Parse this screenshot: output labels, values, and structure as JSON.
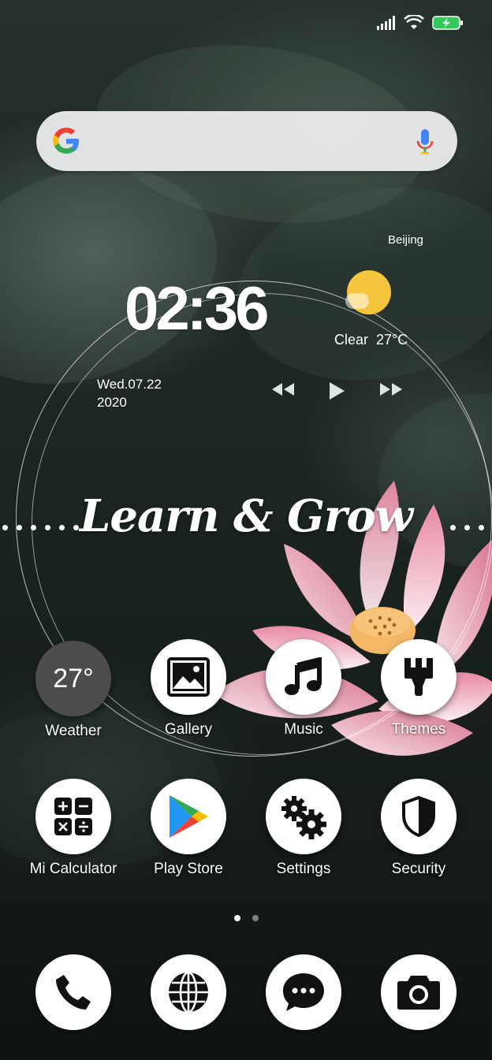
{
  "status_bar": {
    "icons": [
      "signal-icon",
      "wifi-icon",
      "battery-charging-icon"
    ]
  },
  "search": {
    "icons": [
      "google-logo-icon",
      "microphone-icon"
    ]
  },
  "clock_widget": {
    "time": "02:36",
    "date_line1": "Wed.07.22",
    "date_line2": "2020",
    "city": "Beijing",
    "condition": "Clear",
    "temperature": "27°C",
    "media_controls": [
      "rewind-icon",
      "play-icon",
      "fast-forward-icon"
    ]
  },
  "slogan": "Learn & Grow",
  "apps_row1": [
    {
      "label": "Weather",
      "icon": "weather-icon",
      "value": "27°"
    },
    {
      "label": "Gallery",
      "icon": "image-icon"
    },
    {
      "label": "Music",
      "icon": "music-note-icon"
    },
    {
      "label": "Themes",
      "icon": "brush-icon"
    }
  ],
  "apps_row2": [
    {
      "label": "Mi Calculator",
      "icon": "calculator-icon"
    },
    {
      "label": "Play Store",
      "icon": "play-store-icon"
    },
    {
      "label": "Settings",
      "icon": "gears-icon"
    },
    {
      "label": "Security",
      "icon": "shield-icon"
    }
  ],
  "page_indicator": {
    "pages": 2,
    "active": 1
  },
  "dock": [
    "phone-icon",
    "browser-globe-icon",
    "messaging-icon",
    "camera-icon"
  ],
  "colors": {
    "sun": "#f5c63b",
    "search_bg": "#eceeed"
  }
}
